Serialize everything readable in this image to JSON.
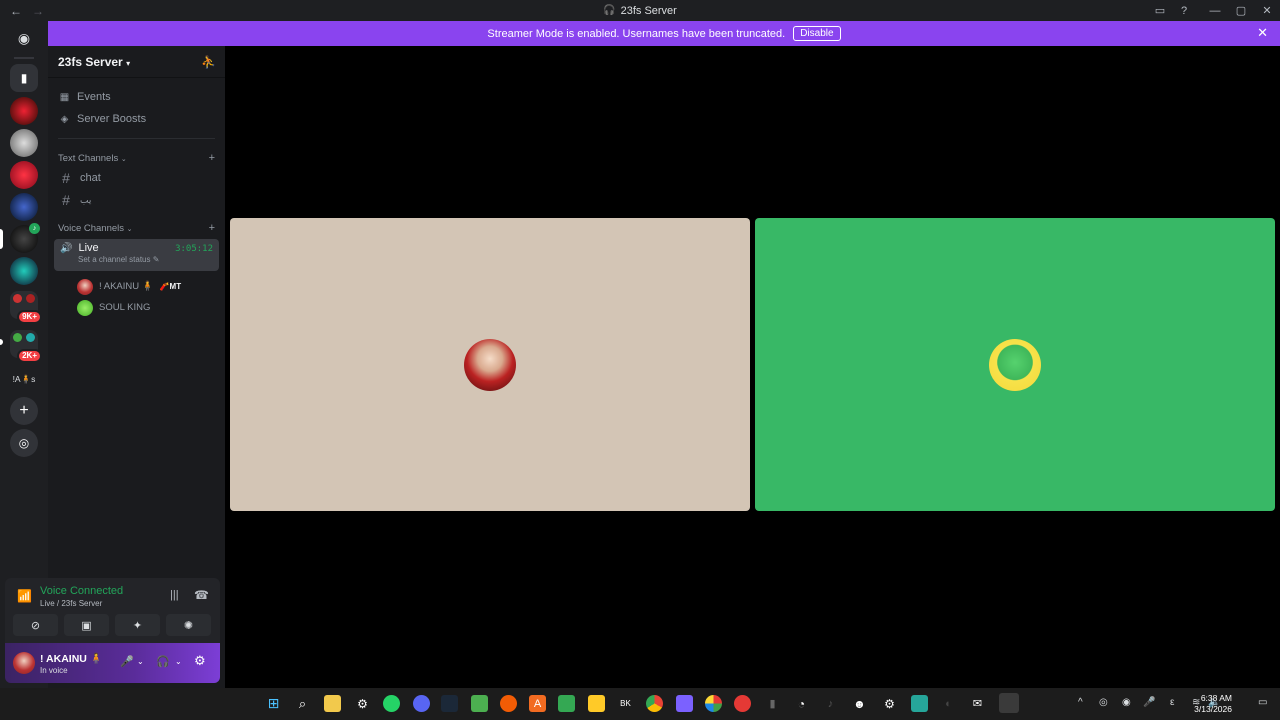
{
  "titlebar": {
    "title": "23fs Server",
    "back_icon": "←",
    "forward_icon": "→"
  },
  "banner": {
    "text": "Streamer Mode is enabled. Usernames have been truncated.",
    "button": "Disable"
  },
  "rail": {
    "badges": [
      "9K+",
      "2K+"
    ],
    "short_label": "!A🧍s"
  },
  "server": {
    "name": "23fs Server",
    "nav": [
      {
        "label": "Events"
      },
      {
        "label": "Server Boosts"
      }
    ],
    "text_category": "Text Channels",
    "text_channels": [
      "chat",
      "يب"
    ],
    "voice_category": "Voice Channels",
    "voice_channel": {
      "name": "Live",
      "timer": "3:05:12",
      "status": "Set a channel status"
    },
    "members": [
      {
        "name": "! AKAINU 🧍",
        "tag": "🧨MT"
      },
      {
        "name": "SOUL KING",
        "tag": ""
      }
    ]
  },
  "voice_panel": {
    "title": "Voice Connected",
    "subtitle": "Live / 23fs Server"
  },
  "user_panel": {
    "name": "! AKAINU 🧍",
    "status": "In voice"
  },
  "clock": {
    "time": "6:38 AM",
    "date": "3/13/2026"
  },
  "colors": {
    "accent": "#8a44ef",
    "connected": "#23a55a",
    "tile_left": "#d3c5b5",
    "tile_right": "#38b866"
  }
}
